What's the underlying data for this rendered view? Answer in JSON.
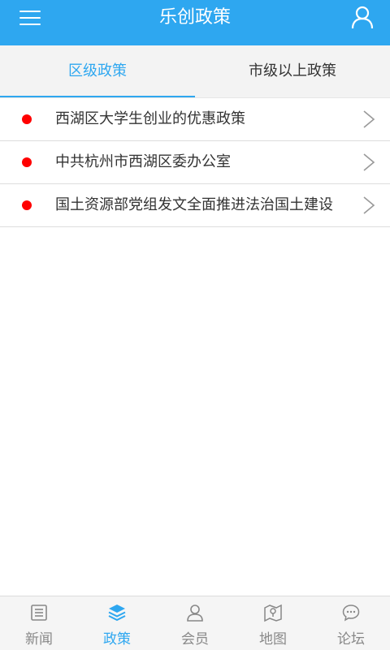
{
  "header": {
    "title": "乐创政策",
    "menu_icon": "menu-icon",
    "user_icon": "user-icon"
  },
  "tabs": [
    {
      "label": "区级政策",
      "active": true
    },
    {
      "label": "市级以上政策",
      "active": false
    }
  ],
  "list": {
    "items": [
      {
        "text": "西湖区大学生创业的优惠政策"
      },
      {
        "text": "中共杭州市西湖区委办公室"
      },
      {
        "text": "国土资源部党组发文全面推进法治国土建设"
      }
    ]
  },
  "bottom_nav": {
    "items": [
      {
        "label": "新闻",
        "icon": "news-icon",
        "active": false
      },
      {
        "label": "政策",
        "icon": "layers-icon",
        "active": true
      },
      {
        "label": "会员",
        "icon": "member-icon",
        "active": false
      },
      {
        "label": "地图",
        "icon": "map-icon",
        "active": false
      },
      {
        "label": "论坛",
        "icon": "chat-icon",
        "active": false
      }
    ]
  },
  "colors": {
    "primary": "#2ea7f0",
    "tab_bar_bg": "#f3f3f3",
    "bullet": "#ff0000",
    "text": "#333333",
    "nav_inactive": "#888888"
  }
}
